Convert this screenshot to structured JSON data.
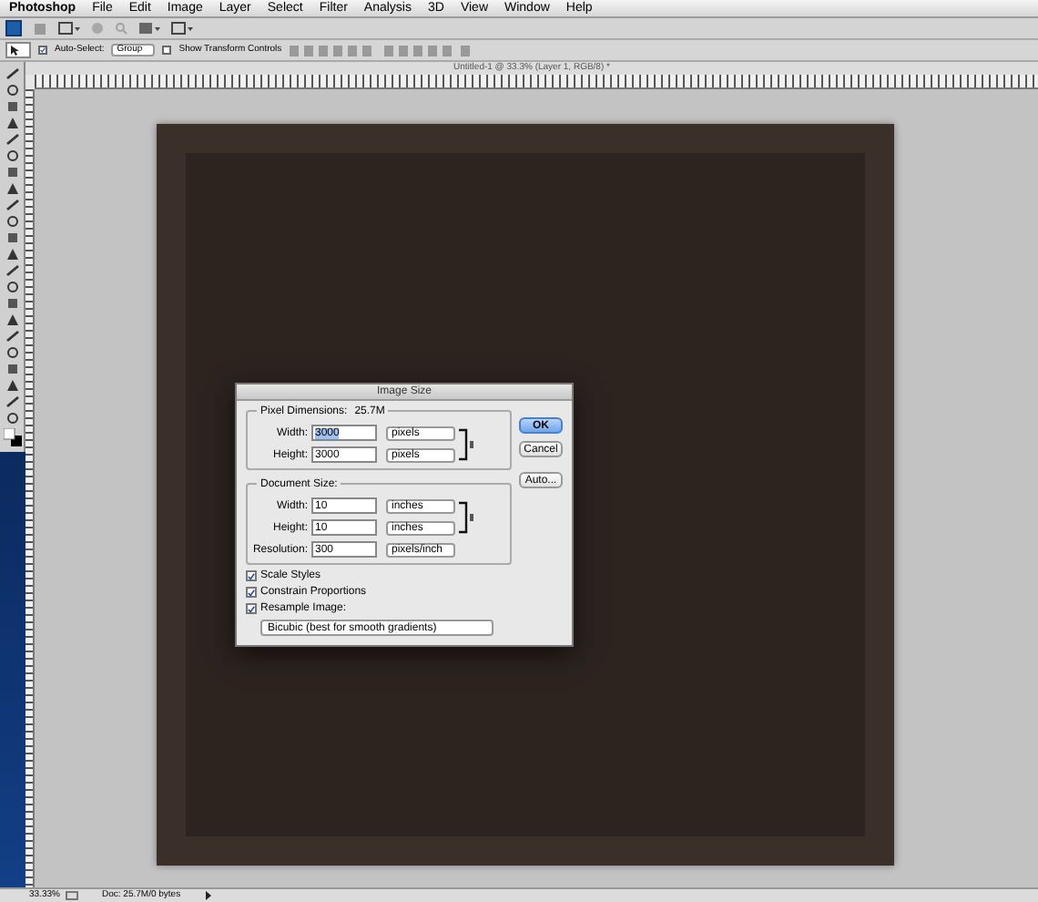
{
  "menu": {
    "app": "Photoshop",
    "items": [
      "File",
      "Edit",
      "Image",
      "Layer",
      "Select",
      "Filter",
      "Analysis",
      "3D",
      "View",
      "Window",
      "Help"
    ]
  },
  "options_bar": {
    "auto_select": {
      "label": "Auto-Select:",
      "checked": true
    },
    "auto_select_target": "Group",
    "show_transform": {
      "label": "Show Transform Controls",
      "checked": false
    }
  },
  "document_tab": {
    "title": "Untitled-1 @ 33.3% (Layer 1, RGB/8) *"
  },
  "dialog": {
    "title": "Image Size",
    "pixel_dimensions": {
      "label": "Pixel Dimensions:",
      "value": "25.7M",
      "linked": true,
      "fields": [
        {
          "label": "Width:",
          "value": "3000",
          "unit": "pixels",
          "selected": true
        },
        {
          "label": "Height:",
          "value": "3000",
          "unit": "pixels",
          "selected": false
        }
      ]
    },
    "document_size": {
      "label": "Document Size:",
      "linked": true,
      "fields": [
        {
          "label": "Width:",
          "value": "10",
          "unit": "inches",
          "selected": false
        },
        {
          "label": "Height:",
          "value": "10",
          "unit": "inches",
          "selected": false
        },
        {
          "label": "Resolution:",
          "value": "300",
          "unit": "pixels/inch",
          "selected": false
        }
      ]
    },
    "checkboxes": [
      {
        "label": "Scale Styles",
        "checked": true
      },
      {
        "label": "Constrain Proportions",
        "checked": true
      },
      {
        "label": "Resample Image:",
        "checked": true
      }
    ],
    "resample_method": "Bicubic (best for smooth gradients)",
    "buttons": [
      {
        "label": "OK",
        "default": true
      },
      {
        "label": "Cancel",
        "default": false
      },
      {
        "label": "Auto...",
        "default": false
      }
    ]
  },
  "status_bar": {
    "zoom": "33.33%",
    "info": "Doc: 25.7M/0 bytes"
  }
}
